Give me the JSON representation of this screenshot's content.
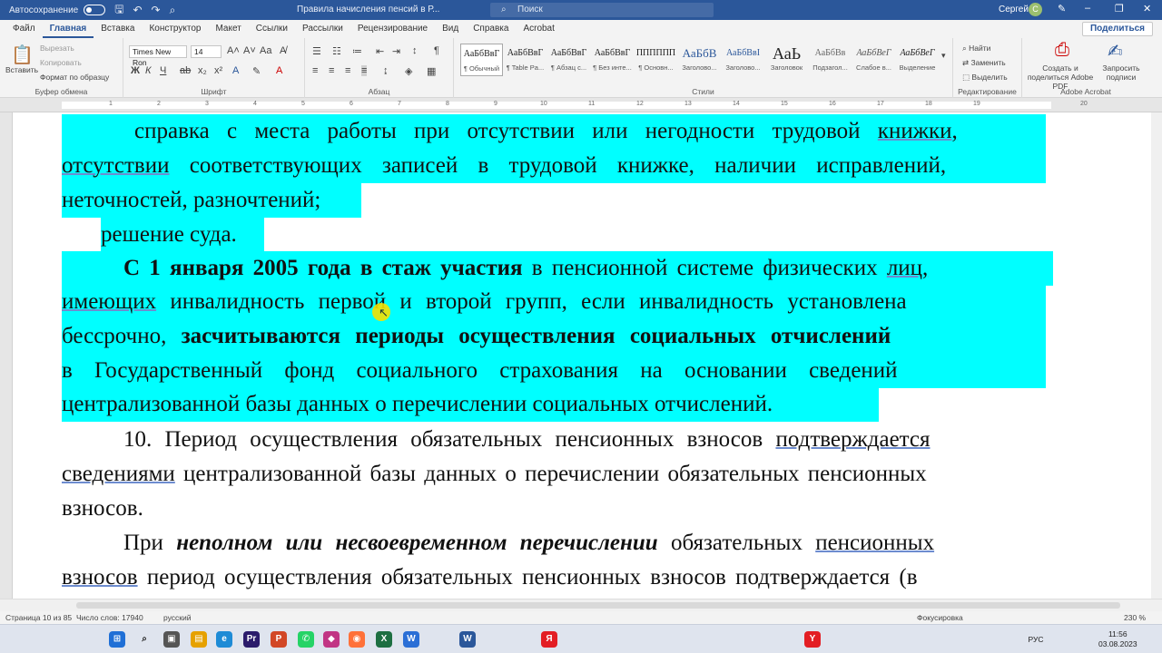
{
  "titlebar": {
    "autosave": "Автосохранение",
    "doc_title": "Правила начисления пенсий в Р...",
    "search_placeholder": "Поиск",
    "user": "Сергей",
    "avatar_letter": "С"
  },
  "menu": {
    "tabs": [
      "Файл",
      "Главная",
      "Вставка",
      "Конструктор",
      "Макет",
      "Ссылки",
      "Рассылки",
      "Рецензирование",
      "Вид",
      "Справка",
      "Acrobat"
    ],
    "share": "Поделиться"
  },
  "ribbon": {
    "clipboard": {
      "label": "Буфер обмена",
      "paste": "Вставить",
      "cut": "Вырезать",
      "copy": "Копировать",
      "format": "Формат по образцу"
    },
    "font": {
      "label": "Шрифт",
      "family": "Times New Ron",
      "size": "14"
    },
    "paragraph": {
      "label": "Абзац"
    },
    "styles": {
      "label": "Стили",
      "items": [
        {
          "sample": "АаБбВвГ",
          "name": "¶ Обычный"
        },
        {
          "sample": "АаБбВвГ",
          "name": "¶ Table Pa..."
        },
        {
          "sample": "АаБбВвГ",
          "name": "¶ Абзац с..."
        },
        {
          "sample": "АаБбВвГ",
          "name": "¶ Без инте..."
        },
        {
          "sample": "ПППППП",
          "name": "¶ Основн..."
        },
        {
          "sample": "АаБбВ",
          "name": "Заголово..."
        },
        {
          "sample": "АаБбВвI",
          "name": "Заголово..."
        },
        {
          "sample": "АаЬ",
          "name": "Заголовок"
        },
        {
          "sample": "АаБбВв",
          "name": "Подзагол..."
        },
        {
          "sample": "АаБбВеГ",
          "name": "Слабое в..."
        },
        {
          "sample": "АаБбВеГ",
          "name": "Выделение"
        }
      ]
    },
    "editing": {
      "label": "Редактирование",
      "find": "Найти",
      "replace": "Заменить",
      "select": "Выделить"
    },
    "acrobat": {
      "label": "Adobe Acrobat",
      "create": "Создать и поделиться Adobe PDF",
      "request": "Запросить подписи"
    }
  },
  "ruler": {
    "numbers": [
      "1",
      "2",
      "3",
      "4",
      "5",
      "6",
      "7",
      "8",
      "9",
      "10",
      "11",
      "12",
      "13",
      "14",
      "15",
      "16",
      "17",
      "18",
      "19",
      "20"
    ]
  },
  "document": {
    "p1a": "справка с места работы при отсутствии или негодности трудовой",
    "p1b": "книжки,",
    "p1c": "отсутствии",
    "p1d": "соответствующих записей в трудовой книжке, наличии исправлений,",
    "p1e": "неточностей, разночтений;",
    "p2": "решение суда.",
    "p3a": "С 1 января 2005 года в стаж участия",
    "p3b": "в пенсионной системе физических",
    "p3c": "лиц,",
    "p3d": "имеющих",
    "p3e": "инвалидность первой и второй групп, если инвалидность установлена",
    "p3f": "бессрочно,",
    "p3g": "засчитываются периоды осуществления социальных отчислений",
    "p3h": "в Государственный фонд социального страхования на основании сведений",
    "p3i": "централизованной базы данных о перечислении социальных отчислений.",
    "p4a": "10. Период осуществления обязательных пенсионных взносов",
    "p4b": "подтверждается",
    "p4c": "сведениями",
    "p4d": "централизованной базы данных о перечислении обязательных пенсионных",
    "p4e": "взносов.",
    "p5a": "При",
    "p5b": "неполном или несвоевременном перечислении",
    "p5c": "обязательных",
    "p5d": "пенсионных",
    "p5e": "взносов",
    "p5f": "период осуществления обязательных пенсионных взносов подтверждается (в"
  },
  "status": {
    "page": "Страница 10 из 85",
    "words": "Число слов: 17940",
    "lang": "русский",
    "focus": "Фокусировка",
    "zoom": "230 %"
  },
  "taskbar": {
    "time": "11:56",
    "date": "03.08.2023",
    "lang": "РУС"
  },
  "colors": {
    "highlight": "#00ffff",
    "brand": "#2b579a"
  }
}
